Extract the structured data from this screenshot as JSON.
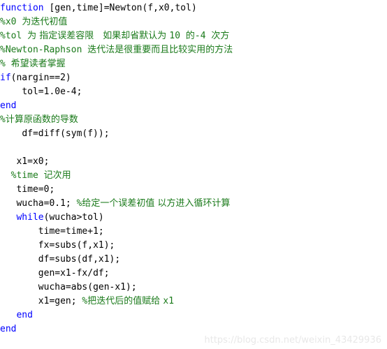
{
  "editor": {
    "language": "MATLAB",
    "background_color": "#ffffff",
    "keyword_color": "#0000ff",
    "comment_color": "#1a7a1a",
    "text_color": "#000000",
    "lines": [
      {
        "indent": "",
        "spans": [
          {
            "t": "kw",
            "s": "function"
          },
          {
            "t": "plain",
            "s": " [gen,time]=Newton(f,x0,tol)"
          }
        ]
      },
      {
        "indent": "",
        "spans": [
          {
            "t": "cmt",
            "s": "%x0 "
          },
          {
            "t": "cmt-cjk",
            "s": "为迭代初值"
          }
        ]
      },
      {
        "indent": "",
        "spans": [
          {
            "t": "cmt",
            "s": "%tol "
          },
          {
            "t": "cmt-cjk",
            "s": "为 指定误差容限　如果却省默认为 "
          },
          {
            "t": "cmt",
            "s": "10 "
          },
          {
            "t": "cmt-cjk",
            "s": "的"
          },
          {
            "t": "cmt",
            "s": "-4 "
          },
          {
            "t": "cmt-cjk",
            "s": "次方"
          }
        ]
      },
      {
        "indent": "",
        "spans": [
          {
            "t": "cmt",
            "s": "%Newton-Raphson "
          },
          {
            "t": "cmt-cjk",
            "s": "迭代法是很重要而且比较实用的方法"
          }
        ]
      },
      {
        "indent": "",
        "spans": [
          {
            "t": "cmt",
            "s": "% "
          },
          {
            "t": "cmt-cjk",
            "s": "希望读者掌握"
          }
        ]
      },
      {
        "indent": "",
        "spans": [
          {
            "t": "kw",
            "s": "if"
          },
          {
            "t": "plain",
            "s": "(nargin==2)"
          }
        ]
      },
      {
        "indent": "    ",
        "spans": [
          {
            "t": "plain",
            "s": "tol=1.0e-4;"
          }
        ]
      },
      {
        "indent": "",
        "spans": [
          {
            "t": "kw",
            "s": "end"
          }
        ]
      },
      {
        "indent": "",
        "spans": [
          {
            "t": "cmt",
            "s": "%"
          },
          {
            "t": "cmt-cjk",
            "s": "计算原函数的导数"
          }
        ]
      },
      {
        "indent": "    ",
        "spans": [
          {
            "t": "plain",
            "s": "df=diff(sym(f));"
          }
        ]
      },
      {
        "indent": "",
        "spans": []
      },
      {
        "indent": "   ",
        "spans": [
          {
            "t": "plain",
            "s": "x1=x0;"
          }
        ]
      },
      {
        "indent": "  ",
        "spans": [
          {
            "t": "cmt",
            "s": "%time "
          },
          {
            "t": "cmt-cjk",
            "s": "记次用"
          }
        ]
      },
      {
        "indent": "   ",
        "spans": [
          {
            "t": "plain",
            "s": "time=0;"
          }
        ]
      },
      {
        "indent": "   ",
        "spans": [
          {
            "t": "plain",
            "s": "wucha=0.1; "
          },
          {
            "t": "cmt",
            "s": "%"
          },
          {
            "t": "cmt-cjk",
            "s": "给定一个误差初值 以方进入循环计算"
          }
        ]
      },
      {
        "indent": "   ",
        "spans": [
          {
            "t": "kw",
            "s": "while"
          },
          {
            "t": "plain",
            "s": "(wucha>tol)"
          }
        ]
      },
      {
        "indent": "       ",
        "spans": [
          {
            "t": "plain",
            "s": "time=time+1;"
          }
        ]
      },
      {
        "indent": "       ",
        "spans": [
          {
            "t": "plain",
            "s": "fx=subs(f,x1);"
          }
        ]
      },
      {
        "indent": "       ",
        "spans": [
          {
            "t": "plain",
            "s": "df=subs(df,x1);"
          }
        ]
      },
      {
        "indent": "       ",
        "spans": [
          {
            "t": "plain",
            "s": "gen=x1-fx/df;"
          }
        ]
      },
      {
        "indent": "       ",
        "spans": [
          {
            "t": "plain",
            "s": "wucha=abs(gen-x1);"
          }
        ]
      },
      {
        "indent": "       ",
        "spans": [
          {
            "t": "plain",
            "s": "x1=gen; "
          },
          {
            "t": "cmt",
            "s": "%"
          },
          {
            "t": "cmt-cjk",
            "s": "把迭代后的值赋给 "
          },
          {
            "t": "cmt",
            "s": "x1"
          }
        ]
      },
      {
        "indent": "   ",
        "spans": [
          {
            "t": "kw",
            "s": "end"
          }
        ]
      },
      {
        "indent": "",
        "spans": [
          {
            "t": "kw",
            "s": "end"
          }
        ]
      }
    ]
  },
  "watermark": {
    "text": "https://blog.csdn.net/weixin_43429936"
  }
}
